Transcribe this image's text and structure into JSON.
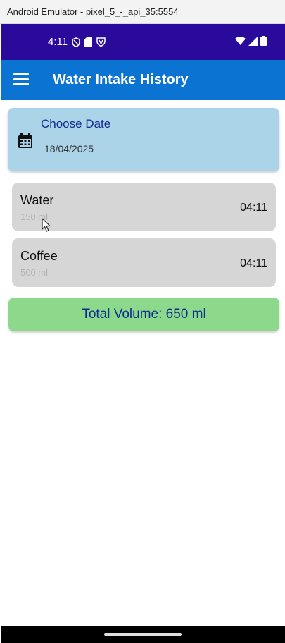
{
  "window": {
    "title": "Android Emulator - pixel_5_-_api_35:5554"
  },
  "status_bar": {
    "time": "4:11"
  },
  "app_bar": {
    "title": "Water Intake History"
  },
  "date_picker": {
    "label": "Choose Date",
    "value": "18/04/2025"
  },
  "entries": [
    {
      "name": "Water",
      "volume": "150 ml",
      "time": "04:11"
    },
    {
      "name": "Coffee",
      "volume": "500 ml",
      "time": "04:11"
    }
  ],
  "total": {
    "text": "Total Volume: 650 ml"
  },
  "colors": {
    "status_bar": "#2a0a9a",
    "app_bar": "#0b73d1",
    "date_card": "#acd4e8",
    "entry_card": "#d6d6d6",
    "total_card": "#8cd98c",
    "accent_text": "#102c8f"
  },
  "icons": {
    "menu": "hamburger-menu-icon",
    "date": "calendar-icon",
    "status": [
      "shield-icon",
      "sd-card-icon",
      "vpn-icon",
      "wifi-icon",
      "signal-icon",
      "battery-icon"
    ]
  }
}
